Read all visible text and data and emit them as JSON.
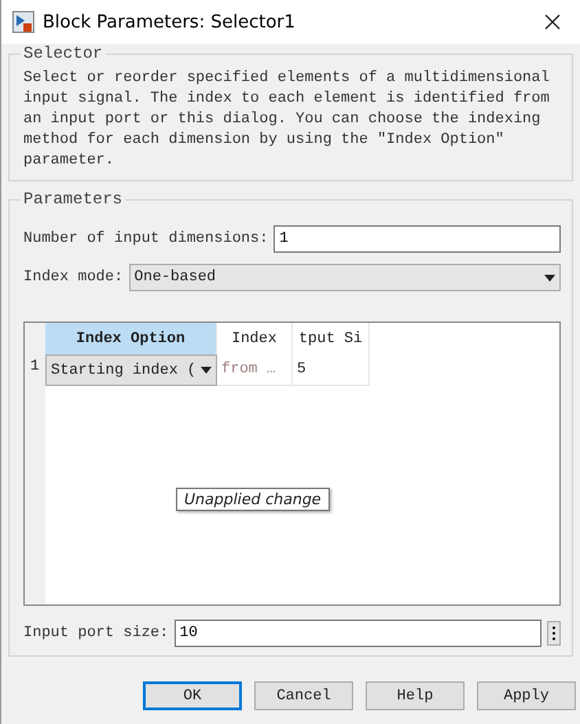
{
  "window": {
    "title": "Block Parameters: Selector1"
  },
  "selector_group": {
    "title": "Selector",
    "description": "Select or reorder specified elements of a multidimensional input signal. The index to each element is identified from an input port or this dialog. You can choose the indexing method for each dimension by using the \"Index Option\" parameter."
  },
  "parameters_group": {
    "title": "Parameters",
    "dimensions_field": {
      "label": "Number of input dimensions:",
      "value": "1"
    },
    "index_mode": {
      "label": "Index mode:",
      "value": "One-based"
    },
    "table": {
      "columns": [
        {
          "label": "Index Option",
          "selected": true
        },
        {
          "label": "Index",
          "selected": false
        },
        {
          "label": "tput Si",
          "selected": false
        }
      ],
      "rows": [
        {
          "number": "1",
          "cells": [
            {
              "kind": "dropdown",
              "value": "Starting index (",
              "disabled": false
            },
            {
              "kind": "text",
              "value": "from …",
              "disabled": true
            },
            {
              "kind": "text",
              "value": "5",
              "disabled": false
            }
          ]
        }
      ]
    },
    "tooltip": "Unapplied change",
    "port_size_field": {
      "label": "Input port size:",
      "value": "10"
    }
  },
  "buttons": [
    {
      "label": "OK",
      "default": true
    },
    {
      "label": "Cancel",
      "default": false
    },
    {
      "label": "Help",
      "default": false
    },
    {
      "label": "Apply",
      "default": false
    }
  ]
}
